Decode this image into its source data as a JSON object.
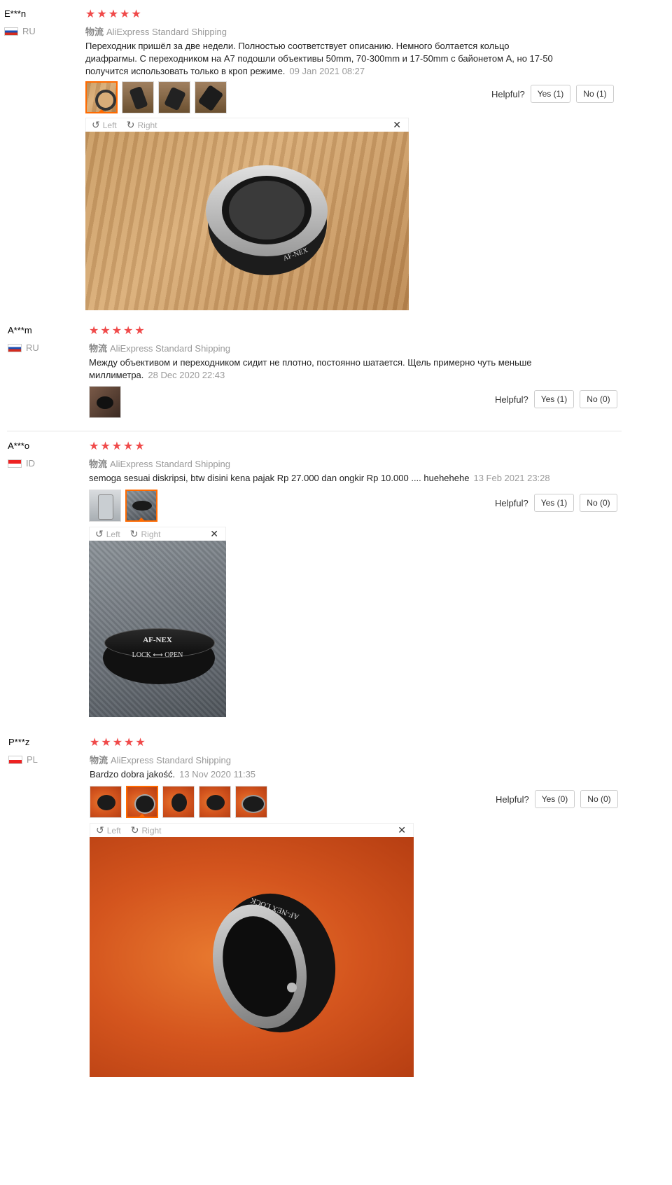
{
  "helpful_label": "Helpful?",
  "shipping_tag": "物流",
  "viewer": {
    "left": "Left",
    "right": "Right"
  },
  "reviews": [
    {
      "user": "E***n",
      "country": "RU",
      "stars": "★★★★★",
      "shipping": "AliExpress Standard Shipping",
      "text": "Переходник пришёл за две недели. Полностью соответствует описанию. Немного болтается кольцо диафрагмы. С переходником на А7 подошли объективы 50mm, 70-300mm и 17-50mm с байонетом А, но 17-50 получится использовать только в кроп режиме.",
      "date": "09 Jan 2021 08:27",
      "yes": "Yes (1)",
      "no": "No (1)",
      "photo_caption": "AF-NEX"
    },
    {
      "user": "A***m",
      "country": "RU",
      "stars": "★★★★★",
      "shipping": "AliExpress Standard Shipping",
      "text": "Между объективом и переходником сидит не плотно, постоянно шатается. Щель примерно чуть меньше миллиметра.",
      "date": "28 Dec 2020 22:43",
      "yes": "Yes (1)",
      "no": "No (0)"
    },
    {
      "user": "A***o",
      "country": "ID",
      "stars": "★★★★★",
      "shipping": "AliExpress Standard Shipping",
      "text": "semoga sesuai diskripsi, btw disini kena pajak Rp 27.000 dan ongkir Rp 10.000 .... huehehehe",
      "date": "13 Feb 2021 23:28",
      "yes": "Yes (1)",
      "no": "No (0)",
      "photo_caption": "AF-NEX",
      "photo_caption2": "LOCK ⟷ OPEN"
    },
    {
      "user": "P***z",
      "country": "PL",
      "stars": "★★★★★",
      "shipping": "AliExpress Standard Shipping",
      "text": "Bardzo dobra jakość.",
      "date": "13 Nov 2020 11:35",
      "yes": "Yes (0)",
      "no": "No (0)",
      "photo_caption": "AF-NEX LOCK"
    }
  ]
}
